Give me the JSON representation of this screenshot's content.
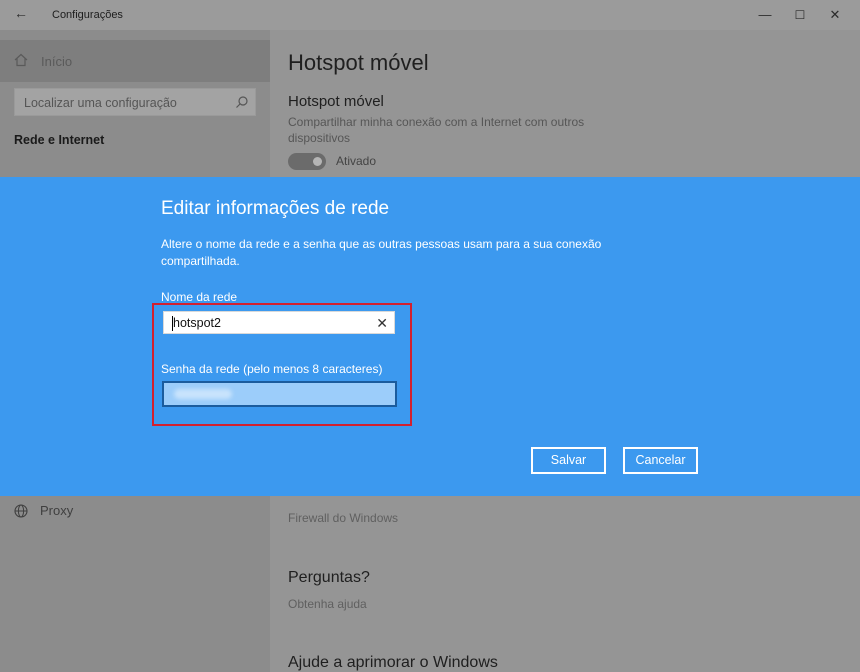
{
  "window": {
    "title": "Configurações",
    "back_icon": "←",
    "minimize_icon": "—",
    "maximize_icon": "☐",
    "close_icon": "✕"
  },
  "sidebar": {
    "home_label": "Início",
    "search_placeholder": "Localizar uma configuração",
    "section_label": "Rede e Internet",
    "proxy_label": "Proxy"
  },
  "main": {
    "page_title": "Hotspot móvel",
    "setting_title": "Hotspot móvel",
    "setting_description": "Compartilhar minha conexão com a Internet com outros dispositivos",
    "toggle_state": "Ativado",
    "firewall_link": "Firewall do Windows",
    "questions_title": "Perguntas?",
    "help_link": "Obtenha ajuda",
    "improve_title": "Ajude a aprimorar o Windows"
  },
  "dialog": {
    "title": "Editar informações de rede",
    "description": "Altere o nome da rede e a senha que as outras pessoas usam para a sua conexão compartilhada.",
    "network_name_label": "Nome da rede",
    "network_name_value": "hotspot2",
    "clear_icon": "✕",
    "password_label": "Senha da rede (pelo menos 8 caracteres)",
    "save_label": "Salvar",
    "cancel_label": "Cancelar"
  },
  "colors": {
    "dialog_bg": "#3c99ef",
    "highlight_border": "#d3202f"
  }
}
